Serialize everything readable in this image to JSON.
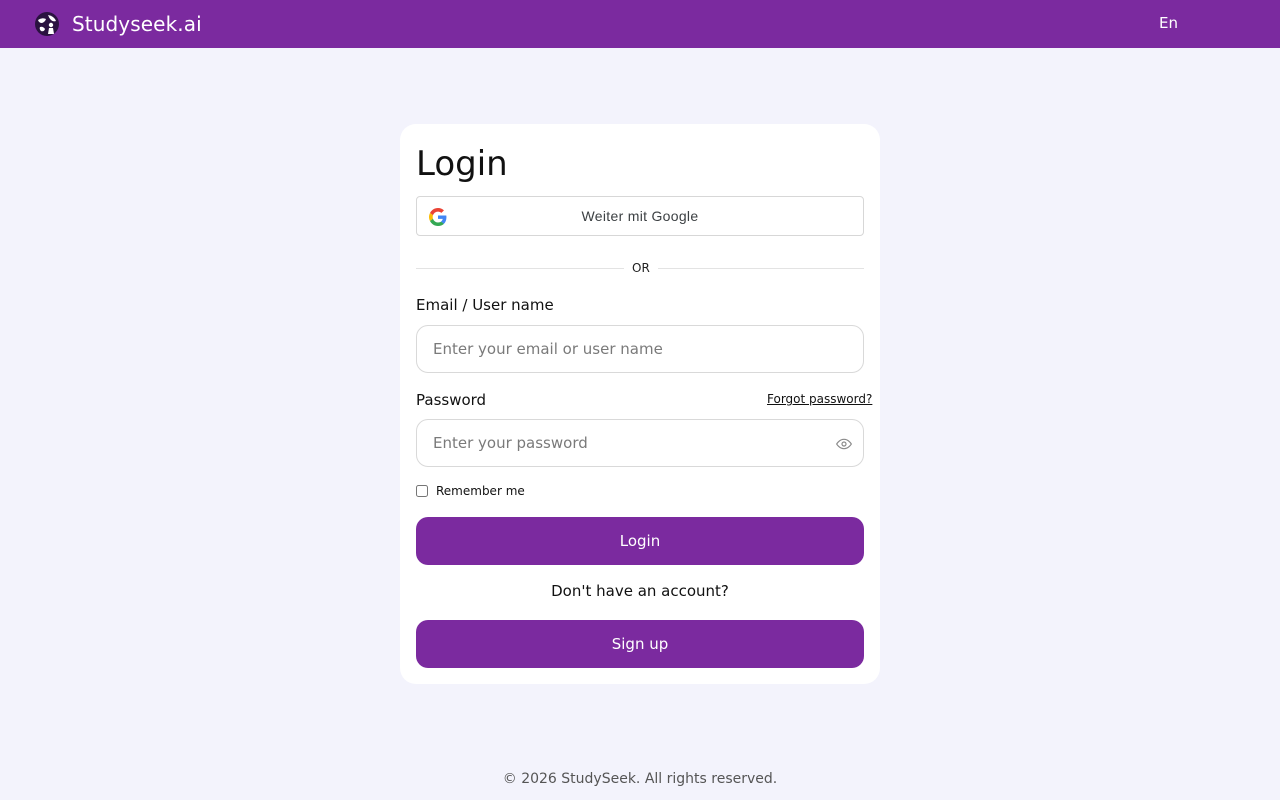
{
  "header": {
    "brand_name": "Studyseek.ai",
    "language": "En",
    "background_color": "#7b2a9f",
    "logo_icon": "globe-person-icon"
  },
  "login_card": {
    "title": "Login",
    "google_button_label": "Weiter mit Google",
    "divider_text": "OR",
    "email_label": "Email / User name",
    "email_placeholder": "Enter your email or user name",
    "password_label": "Password",
    "password_placeholder": "Enter your password",
    "forgot_password": "Forgot password?",
    "remember_me": "Remember me",
    "login_button": "Login",
    "no_account_text": "Don't have an account?",
    "signup_button": "Sign up",
    "accent_color": "#7b2a9f"
  },
  "footer": {
    "copyright": "© 2026 StudySeek. All rights reserved."
  }
}
